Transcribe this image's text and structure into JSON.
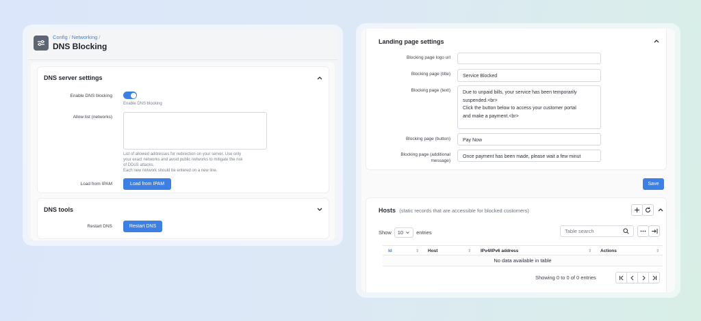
{
  "left": {
    "breadcrumb": [
      "Config",
      "Networking"
    ],
    "breadcrumb_sep": "/",
    "title": "DNS Blocking",
    "dns_server": {
      "title": "DNS server settings",
      "enable_label": "Enable DNS blocking",
      "enable_hint": "Enable DNS blocking",
      "enabled": true,
      "allow_label": "Allow list (networks)",
      "allow_value": "",
      "allow_hint_1": "List of allowed addresses for redirection on your server. Use only",
      "allow_hint_2": "your exact networks and avoid public networks to mitigate the risk",
      "allow_hint_3": "of DDoS attacks.",
      "allow_hint_4": "Each new network should be entered on a new line.",
      "ipam_label": "Load from IPAM",
      "ipam_button": "Load from IPAM"
    },
    "dns_tools": {
      "title": "DNS tools",
      "restart_label": "Restart DNS",
      "restart_button": "Restart DNS"
    }
  },
  "right": {
    "landing": {
      "title": "Landing page settings",
      "logo_label": "Blocking page logo url",
      "logo_value": "",
      "title_label": "Blocking page (title)",
      "title_value": "Service Blocked",
      "text_label": "Blocking page (text)",
      "text_line_1": "Due to unpaid bills, your service has been temporarily",
      "text_line_2": "suspended.<br>",
      "text_line_3": "Click the button below to access your customer portal",
      "text_line_4": "and make a payment.<br>",
      "button_label": "Blocking page (button)",
      "button_value": "Pay Now",
      "additional_label_1": "Blocking page (additional",
      "additional_label_2": "message)",
      "additional_value": "Once payment has been made, please wait a few minut",
      "save_button": "Save"
    },
    "hosts": {
      "title": "Hosts",
      "subtitle": "(static records that are accessible for blocked customers)",
      "show_label": "Show",
      "entries_value": "10",
      "entries_label": "entries",
      "search_placeholder": "Table search",
      "columns": [
        "Id",
        "Host",
        "IPv4/IPv6 address",
        "Actions"
      ],
      "empty_text": "No data available in table",
      "showing_text": "Showing 0 to 0 of 0 entries"
    }
  },
  "colors": {
    "accent": "#3c80e6",
    "link": "#3d7de0"
  }
}
